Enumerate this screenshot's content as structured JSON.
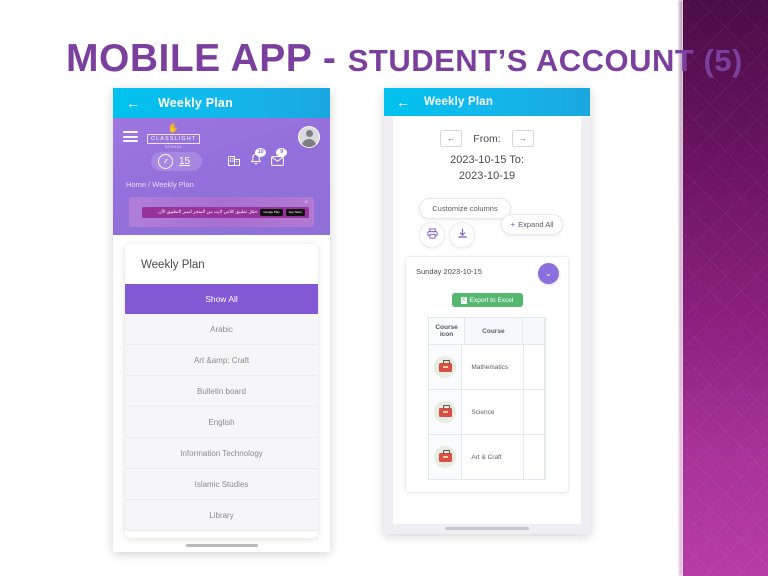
{
  "slide": {
    "title_main": "MOBILE APP - ",
    "title_sub": "STUDENT’S ACCOUNT (5)",
    "accent_purple": "#7b3f9e",
    "band_top_color": "#4b0d47",
    "band_bottom_color": "#b63ca4"
  },
  "phone_left": {
    "app_bar": {
      "back_icon": "←",
      "title": "Weekly Plan",
      "bg_color": "#12b9ec"
    },
    "header": {
      "menu_icon": "hamburger-icon",
      "brand_mark": "✋",
      "brand_name": "CLASSLIGHT",
      "brand_sub": "SCHOOL",
      "points_value": "15",
      "gauge_icon": "speedometer-icon",
      "building_icon": "Ἶ2",
      "bell_badge": "10",
      "mail_badge": "9",
      "avatar_icon": "avatar-icon",
      "breadcrumb": "Home / Weekly Plan"
    },
    "promo": {
      "arabic_text": "حمّل تطبيق كلاس لايت من المتجر لتميز التطبيق الآن",
      "store_apple": "App Store",
      "store_google": "Google Play",
      "close_icon": "×"
    },
    "card": {
      "title": "Weekly Plan",
      "items": [
        {
          "label": "Show All",
          "active": true
        },
        {
          "label": "Arabic",
          "active": false
        },
        {
          "label": "Art &amp; Craft",
          "active": false
        },
        {
          "label": "Bulletin board",
          "active": false
        },
        {
          "label": "English",
          "active": false
        },
        {
          "label": "Information Technology",
          "active": false
        },
        {
          "label": "Islamic Studies",
          "active": false
        },
        {
          "label": "Library",
          "active": false
        }
      ],
      "active_color": "#8358d4"
    }
  },
  "phone_right": {
    "app_bar": {
      "back_icon": "←",
      "title": "Weekly Plan",
      "bg_color": "#12b9ec"
    },
    "date_nav": {
      "prev_icon": "←",
      "next_icon": "→",
      "from_label": "From:",
      "range_line1": "2023-10-15 To:",
      "range_line2": "2023-10-19"
    },
    "toolbar": {
      "customize_columns": "Customize columns",
      "expand_all": "Expand All",
      "expand_plus": "+",
      "print_icon": "printer-icon",
      "download_icon": "download-icon"
    },
    "day_card": {
      "day_label": "Sunday 2023-10-15",
      "collapse_icon": "⌄",
      "export_label": "Export to Excel",
      "export_icon": "excel-icon",
      "export_color": "#56b870"
    },
    "table": {
      "headers": [
        "Course icon",
        "Course",
        ""
      ],
      "rows": [
        {
          "icon": "briefcase-icon",
          "course": "Mathematics"
        },
        {
          "icon": "briefcase-icon",
          "course": "Science"
        },
        {
          "icon": "briefcase-icon",
          "course": "Art & Craft"
        }
      ]
    }
  }
}
